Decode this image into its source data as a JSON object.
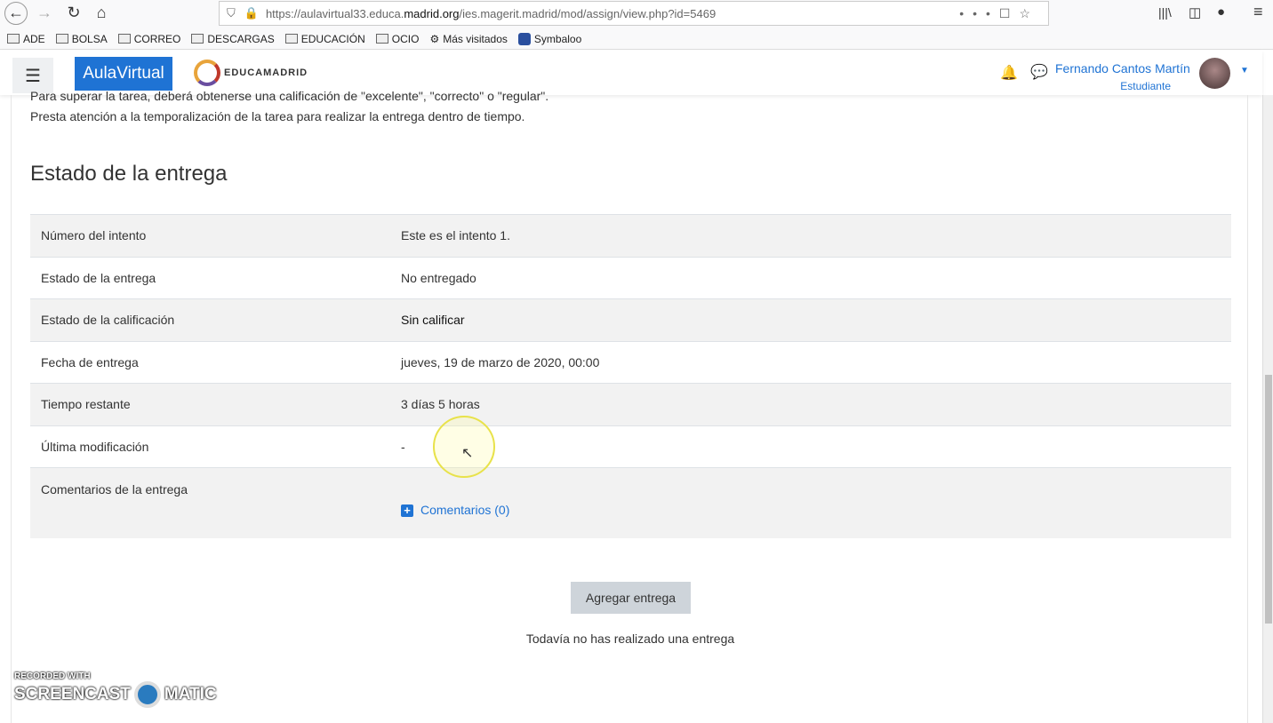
{
  "browser": {
    "url_pre": "https://aulavirtual33.educa.",
    "url_domain": "madrid.org",
    "url_post": "/ies.magerit.madrid/mod/assign/view.php?id=5469",
    "bookmarks": [
      "ADE",
      "BOLSA",
      "CORREO",
      "DESCARGAS",
      "EDUCACIÓN",
      "OCIO",
      "Más visitados",
      "Symbaloo"
    ]
  },
  "header": {
    "brand": "AulaVirtual",
    "logo": "EducaMadrid",
    "user_name": "Fernando Cantos Martín",
    "user_role": "Estudiante"
  },
  "intro": {
    "line1": "Para superar la tarea, deberá obtenerse una calificación de \"excelente\", \"correcto\" o \"regular\".",
    "line2": "Presta atención a la temporalización de la tarea para realizar la entrega dentro de tiempo."
  },
  "section_title": "Estado de la entrega",
  "rows": [
    {
      "label": "Número del intento",
      "value": "Este es el intento 1."
    },
    {
      "label": "Estado de la entrega",
      "value": "No entregado"
    },
    {
      "label": "Estado de la calificación",
      "value": "Sin calificar"
    },
    {
      "label": "Fecha de entrega",
      "value": "jueves, 19 de marzo de 2020, 00:00"
    },
    {
      "label": "Tiempo restante",
      "value": "3 días 5 horas"
    },
    {
      "label": "Última modificación",
      "value": "-"
    },
    {
      "label": "Comentarios de la entrega",
      "value": "Comentarios (0)"
    }
  ],
  "add_button": "Agregar entrega",
  "no_submission": "Todavía no has realizado una entrega",
  "watermark": {
    "line1": "RECORDED WITH",
    "line2": "SCREENCAST",
    "line3": "MATIC"
  }
}
